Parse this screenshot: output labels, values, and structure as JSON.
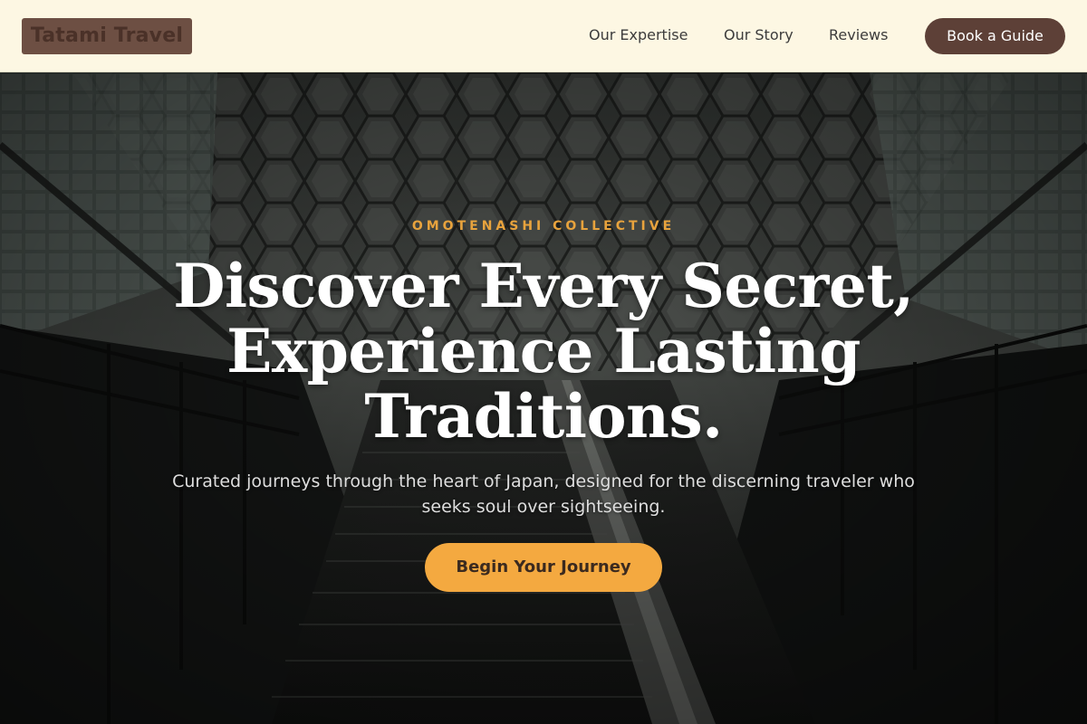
{
  "header": {
    "logo_text": "Tatami Travel",
    "nav": [
      {
        "label": "Our Expertise"
      },
      {
        "label": "Our Story"
      },
      {
        "label": "Reviews"
      }
    ],
    "cta_label": "Book a Guide"
  },
  "hero": {
    "eyebrow": "OMOTENASHI COLLECTIVE",
    "headline": "Discover Every Secret, Experience Lasting Traditions.",
    "subhead": "Curated journeys through the heart of Japan, designed for the discerning traveler who seeks soul over sightseeing.",
    "cta_label": "Begin Your Journey"
  },
  "colors": {
    "header_bg": "#fdf7e3",
    "brand_brown": "#5d4037",
    "accent_orange": "#f4a940",
    "eyebrow_orange": "#e8a33d"
  }
}
